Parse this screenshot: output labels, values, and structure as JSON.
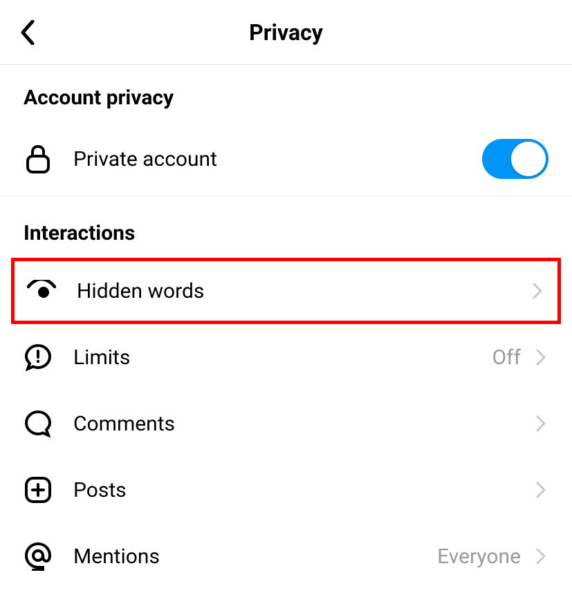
{
  "header": {
    "title": "Privacy"
  },
  "sections": {
    "account_privacy": {
      "title": "Account privacy",
      "private_account_label": "Private account",
      "private_account_enabled": true
    },
    "interactions": {
      "title": "Interactions",
      "items": {
        "hidden_words": {
          "label": "Hidden words",
          "value": ""
        },
        "limits": {
          "label": "Limits",
          "value": "Off"
        },
        "comments": {
          "label": "Comments",
          "value": ""
        },
        "posts": {
          "label": "Posts",
          "value": ""
        },
        "mentions": {
          "label": "Mentions",
          "value": "Everyone"
        }
      }
    }
  }
}
